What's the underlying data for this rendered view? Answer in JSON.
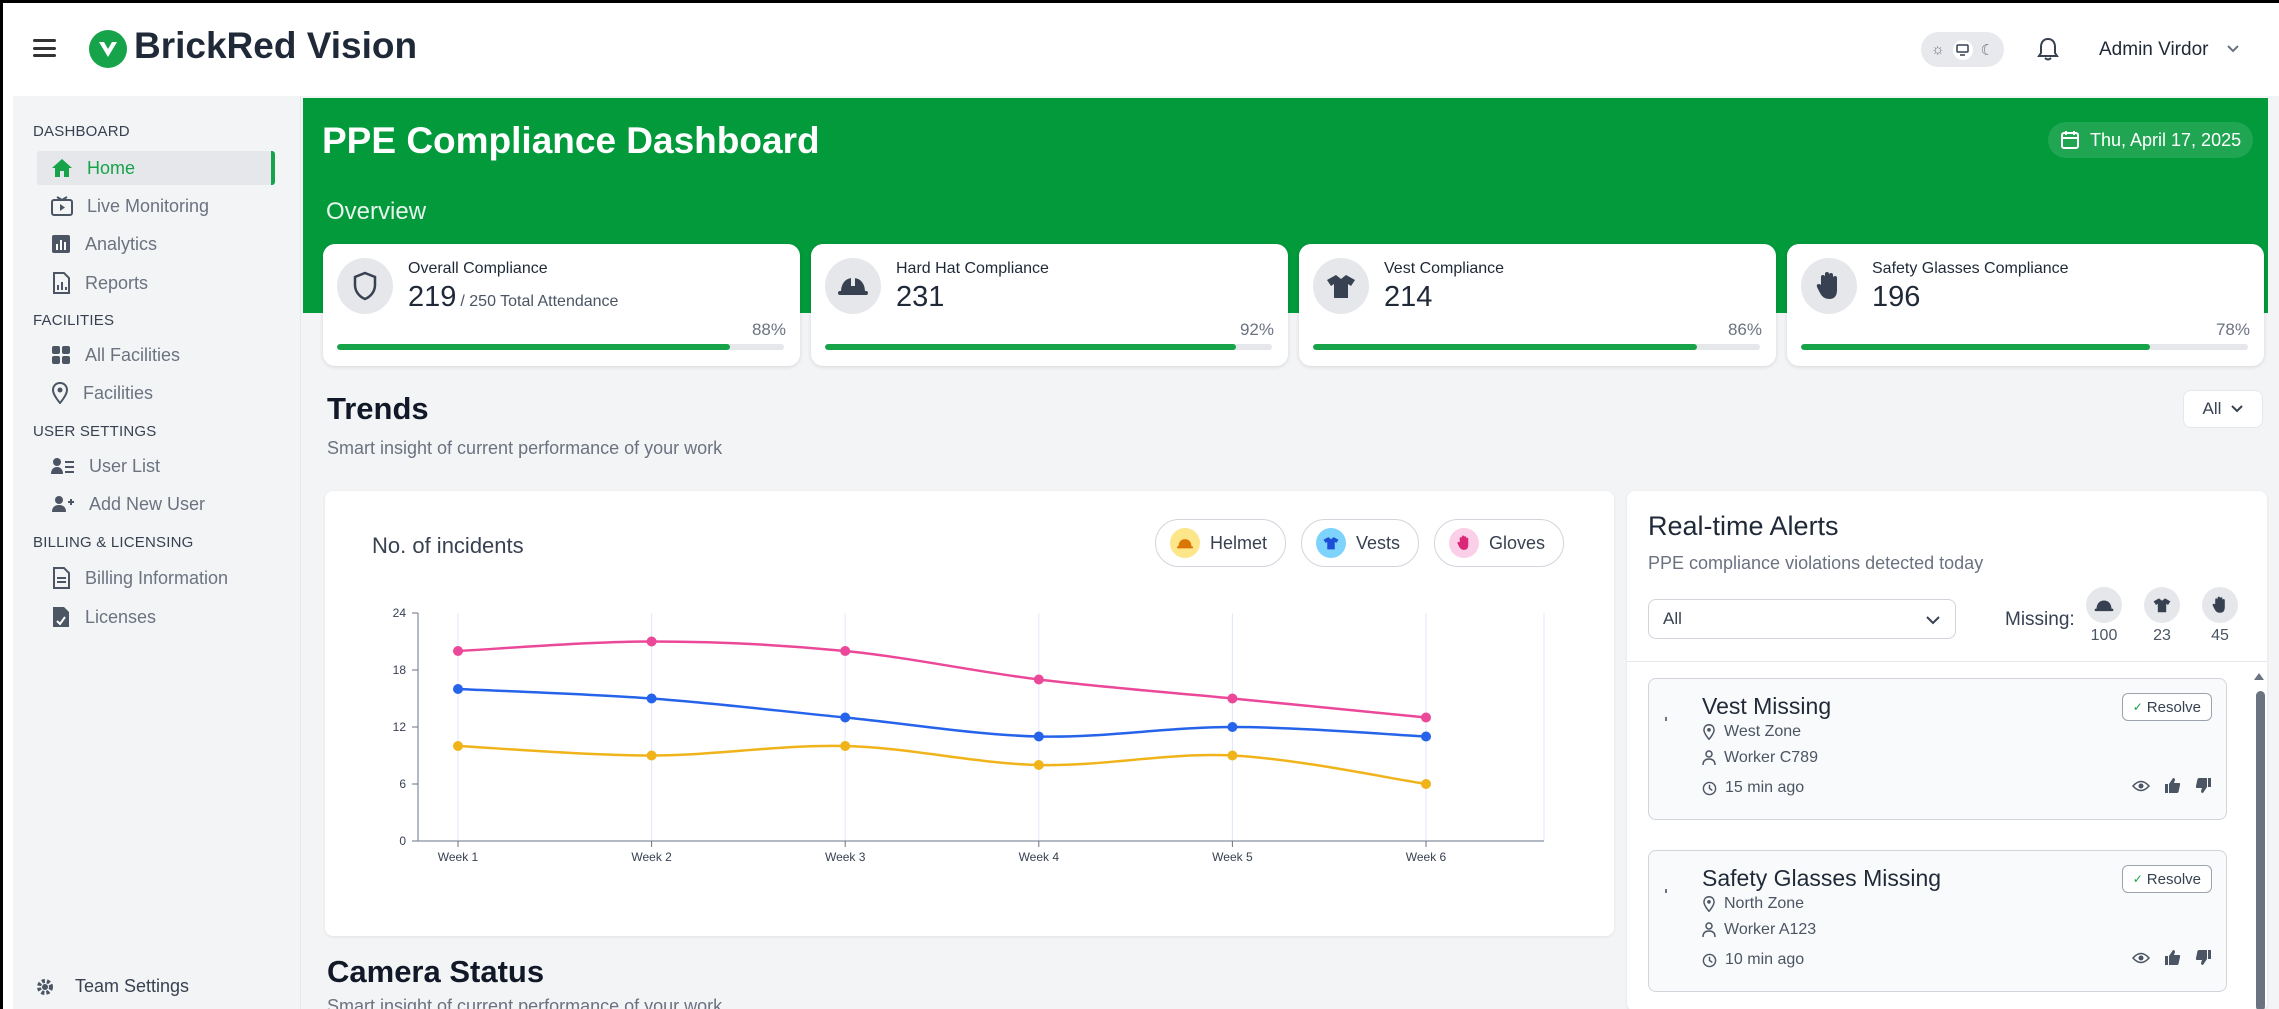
{
  "app": {
    "brand": "BrickRed Vision",
    "admin_name": "Admin Virdor"
  },
  "sidebar": {
    "sections": [
      {
        "label": "DASHBOARD"
      },
      {
        "label": "FACILITIES"
      },
      {
        "label": "USER SETTINGS"
      },
      {
        "label": "BILLING & LICENSING"
      }
    ],
    "items": [
      {
        "label": "Home",
        "icon": "home-icon",
        "active": true
      },
      {
        "label": "Live Monitoring",
        "icon": "tv-play-icon"
      },
      {
        "label": "Analytics",
        "icon": "chart-icon"
      },
      {
        "label": "Reports",
        "icon": "report-icon"
      },
      {
        "label": "All Facilities",
        "icon": "grid-icon"
      },
      {
        "label": "Facilities",
        "icon": "location-pin-icon"
      },
      {
        "label": "User List",
        "icon": "user-list-icon"
      },
      {
        "label": "Add New User",
        "icon": "user-plus-icon"
      },
      {
        "label": "Billing Information",
        "icon": "billing-icon"
      },
      {
        "label": "Licenses",
        "icon": "license-icon"
      }
    ],
    "footer_label": "Team Settings"
  },
  "header": {
    "title": "PPE Compliance Dashboard",
    "date": "Thu, April 17, 2025",
    "overview_label": "Overview"
  },
  "kpis": [
    {
      "label": "Overall Compliance",
      "value": "219",
      "sub": "/ 250 Total Attendance",
      "percent_label": "88%",
      "percent": 88,
      "icon": "shield-icon"
    },
    {
      "label": "Hard Hat Compliance",
      "value": "231",
      "sub": "",
      "percent_label": "92%",
      "percent": 92,
      "icon": "hard-hat-icon"
    },
    {
      "label": "Vest Compliance",
      "value": "214",
      "sub": "",
      "percent_label": "86%",
      "percent": 86,
      "icon": "vest-icon"
    },
    {
      "label": "Safety Glasses Compliance",
      "value": "196",
      "sub": "",
      "percent_label": "78%",
      "percent": 78,
      "icon": "hand-icon"
    }
  ],
  "trends": {
    "title": "Trends",
    "subtitle": "Smart insight of current performance of your work",
    "filter": "All"
  },
  "chart": {
    "legend": [
      {
        "label": "Helmet",
        "icon": "helmet-icon",
        "color": "#fde68a"
      },
      {
        "label": "Vests",
        "icon": "vest-icon",
        "color": "#7dd3fc"
      },
      {
        "label": "Gloves",
        "icon": "glove-icon",
        "color": "#fbcfe8"
      }
    ]
  },
  "chart_data": {
    "type": "line",
    "title": "No. of incidents",
    "categories": [
      "Week 1",
      "Week 2",
      "Week 3",
      "Week 4",
      "Week 5",
      "Week 6"
    ],
    "ylim": [
      0,
      24
    ],
    "yticks": [
      0,
      6,
      12,
      18,
      24
    ],
    "grid": "vertical",
    "series": [
      {
        "name": "Gloves",
        "color": "#ec4899",
        "values": [
          20,
          21,
          20,
          17,
          15,
          13
        ]
      },
      {
        "name": "Vests",
        "color": "#2563eb",
        "values": [
          16,
          15,
          13,
          11,
          12,
          11
        ]
      },
      {
        "name": "Helmet",
        "color": "#f0b31a",
        "values": [
          10,
          9,
          10,
          8,
          9,
          6
        ]
      }
    ]
  },
  "alerts": {
    "title": "Real-time Alerts",
    "subtitle": "PPE compliance violations detected today",
    "filter": "All",
    "missing_label": "Missing:",
    "missing": [
      {
        "icon": "hard-hat-icon",
        "count": "100"
      },
      {
        "icon": "vest-icon",
        "count": "23"
      },
      {
        "icon": "hand-icon",
        "count": "45"
      }
    ],
    "resolve_label": "Resolve",
    "items": [
      {
        "title": "Vest Missing",
        "zone": "West Zone",
        "worker": "Worker C789",
        "time": "15 min ago"
      },
      {
        "title": "Safety Glasses Missing",
        "zone": "North Zone",
        "worker": "Worker A123",
        "time": "10 min ago"
      }
    ]
  },
  "camera": {
    "title": "Camera Status",
    "subtitle": "Smart insight of current performance of your work"
  }
}
